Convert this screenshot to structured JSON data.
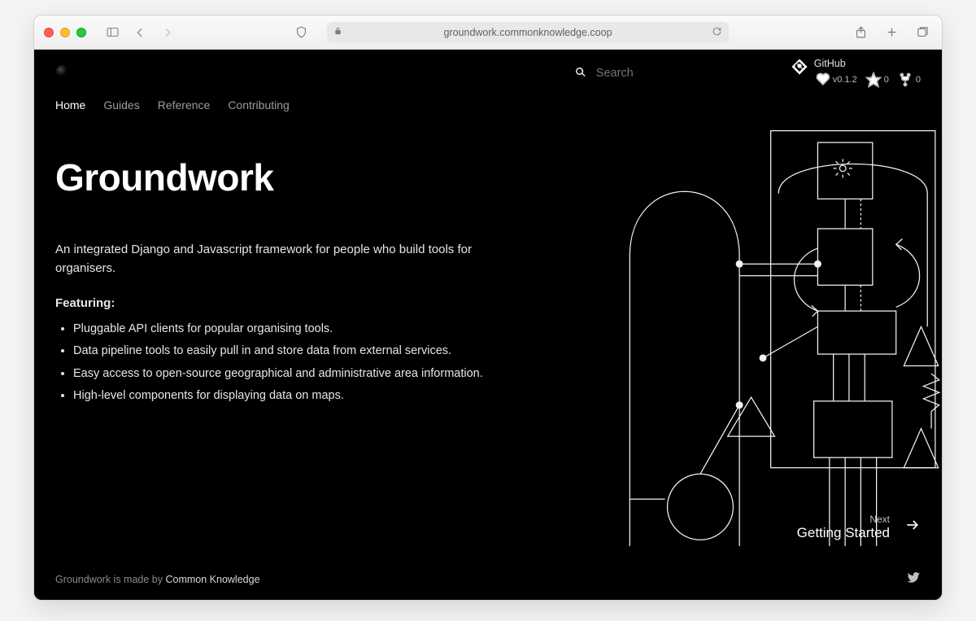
{
  "browser": {
    "url": "groundwork.commonknowledge.coop"
  },
  "header": {
    "search_placeholder": "Search",
    "github": {
      "label": "GitHub",
      "version": "v0.1.2",
      "stars": "0",
      "forks": "0"
    }
  },
  "nav": {
    "items": [
      "Home",
      "Guides",
      "Reference",
      "Contributing"
    ],
    "active_index": 0
  },
  "hero": {
    "title": "Groundwork",
    "lede": "An integrated Django and Javascript framework for people who build tools for organisers.",
    "featuring_label": "Featuring:",
    "features": [
      "Pluggable API clients for popular organising tools.",
      "Data pipeline tools to easily pull in and store data from external services.",
      "Easy access to open-source geographical and administrative area information.",
      "High-level components for displaying data on maps."
    ]
  },
  "next": {
    "label": "Next",
    "title": "Getting Started"
  },
  "footer": {
    "prefix": "Groundwork is made by ",
    "author": "Common Knowledge"
  }
}
